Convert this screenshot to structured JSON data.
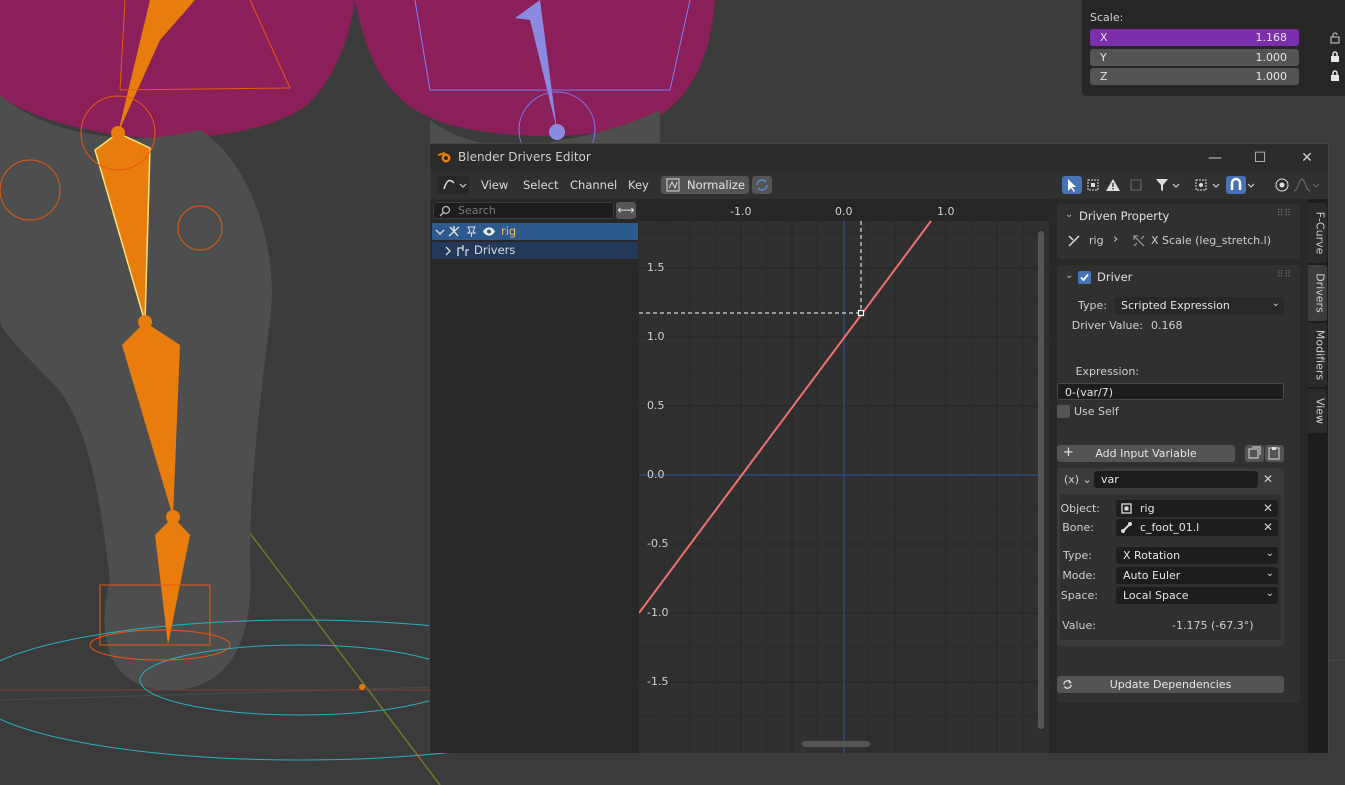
{
  "scale_panel": {
    "label": "Scale:",
    "x": {
      "axis": "X",
      "value": "1.168"
    },
    "y": {
      "axis": "Y",
      "value": "1.000"
    },
    "z": {
      "axis": "Z",
      "value": "1.000"
    }
  },
  "window": {
    "title": "Blender Drivers Editor",
    "controls": {
      "minimize": "—",
      "maximize": "☐",
      "close": "✕"
    }
  },
  "toolbar": {
    "menus": [
      "View",
      "Select",
      "Channel",
      "Key"
    ],
    "normalize_label": "Normalize"
  },
  "channels": {
    "search_placeholder": "Search",
    "swap_icon": "⟷",
    "items": [
      {
        "label": "rig"
      },
      {
        "label": "Drivers"
      }
    ]
  },
  "graph": {
    "x_ticks": [
      "-1.0",
      "0.0",
      "1.0"
    ],
    "y_ticks": [
      "1.5",
      "1.0",
      "0.5",
      "0.0",
      "-0.5",
      "-1.0",
      "-1.5"
    ]
  },
  "driven_property": {
    "title": "Driven Property",
    "object": "rig",
    "property": "X Scale (leg_stretch.l)"
  },
  "driver": {
    "title": "Driver",
    "type_label": "Type:",
    "type_value": "Scripted Expression",
    "value_label": "Driver Value:",
    "value": "0.168",
    "expression_label": "Expression:",
    "expression": "0-(var/7)",
    "use_self": "Use Self",
    "add_variable": "Add Input Variable",
    "variable": {
      "type_icon": "(x)",
      "name": "var",
      "object_label": "Object:",
      "object": "rig",
      "bone_label": "Bone:",
      "bone": "c_foot_01.l",
      "type_label": "Type:",
      "type": "X Rotation",
      "mode_label": "Mode:",
      "mode": "Auto Euler",
      "space_label": "Space:",
      "space": "Local Space",
      "value_label": "Value:",
      "value": "-1.175 (-67.3°)"
    },
    "update_deps": "Update Dependencies"
  },
  "tabs": [
    "F-Curve",
    "Drivers",
    "Modifiers",
    "View"
  ],
  "colors": {
    "accent": "#4772b3",
    "curve": "#f07070",
    "active_field": "#7a2eaa",
    "bone_orange": "#e87d0d"
  }
}
